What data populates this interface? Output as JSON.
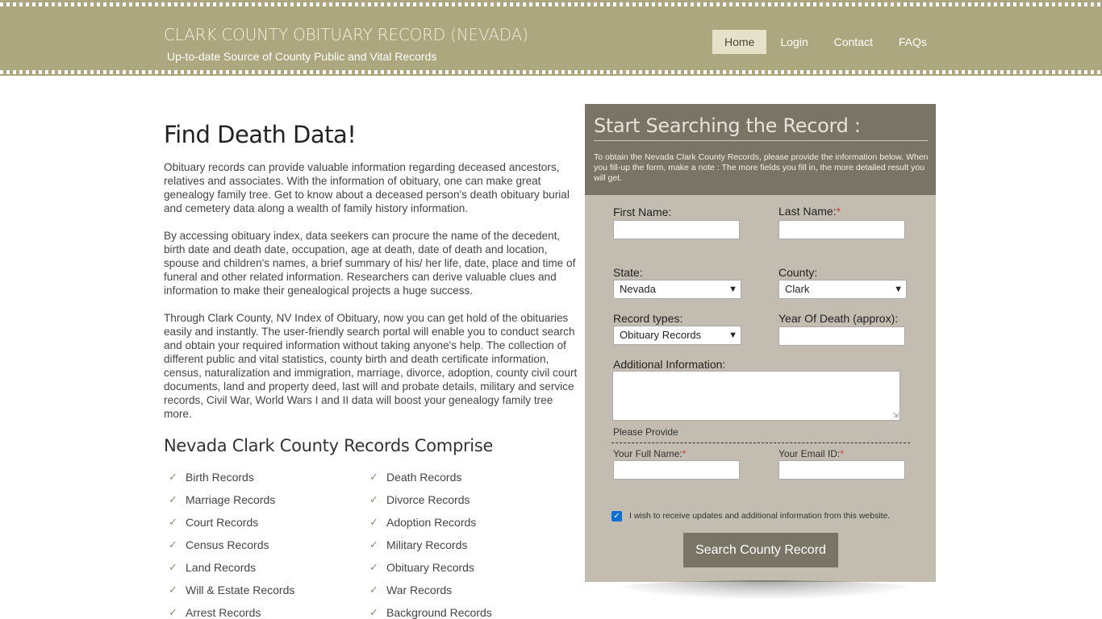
{
  "header": {
    "title_main": "CLARK COUNTY OBITUARY RECORD",
    "title_state": "(NEVADA)",
    "tagline": "Up-to-date Source of  County Public and Vital Records",
    "nav": [
      "Home",
      "Login",
      "Contact",
      "FAQs"
    ],
    "active_nav": "Home"
  },
  "main": {
    "heading": "Find Death Data!",
    "paragraphs": [
      "Obituary records can provide valuable information regarding deceased ancestors, relatives and associates. With the information of obituary, one can make great genealogy family tree. Get to know about a deceased person's death obituary burial and cemetery data along a wealth of family history information.",
      "By accessing obituary index, data seekers can procure the name of the decedent, birth date and death date, occupation, age at death, date of death and location, spouse and children's names, a brief summary of his/ her life, date, place and time of funeral and other related information. Researchers can derive valuable clues and information to make their genealogical projects a huge success.",
      "Through Clark County, NV Index of Obituary, now you can get hold of the obituaries easily and instantly. The user-friendly search portal will enable you to conduct search and obtain your required information without taking anyone's help. The collection of different public and vital statistics, county birth and death certificate information, census, naturalization and immigration, marriage, divorce, adoption, county civil court documents, land and property deed, last will and probate details, military and service records, Civil War, World Wars I and II data will boost your genealogy family tree more."
    ],
    "records_heading": "Nevada Clark County Records Comprise",
    "records_col1": [
      "Birth Records",
      "Marriage Records",
      "Court Records",
      "Census Records",
      "Land Records",
      "Will & Estate Records",
      "Arrest Records"
    ],
    "records_col2": [
      "Death Records",
      "Divorce Records",
      "Adoption Records",
      "Military Records",
      "Obituary Records",
      "War Records",
      "Background Records"
    ],
    "check_icon": "✓"
  },
  "form": {
    "title": "Start Searching the Record :",
    "note": "To obtain the Nevada Clark County Records, please provide the information below. When you fill-up the form, make a note : The more fields you fill in, the more detailed result you will get.",
    "first_name_label": "First Name:",
    "last_name_label": "Last Name:",
    "state_label": "State:",
    "state_value": "Nevada",
    "county_label": "County:",
    "county_value": "Clark",
    "record_types_label": "Record types:",
    "record_types_value": "Obituary Records",
    "year_label": "Year Of Death (approx):",
    "additional_label": "Additional Information:",
    "provide_label": "Please Provide",
    "full_name_label": "Your Full Name:",
    "email_label": "Your Email ID:",
    "required_mark": "*",
    "consent_text": "I wish to receive updates and additional information from this website.",
    "consent_checked": true,
    "submit_label": "Search County Record"
  }
}
